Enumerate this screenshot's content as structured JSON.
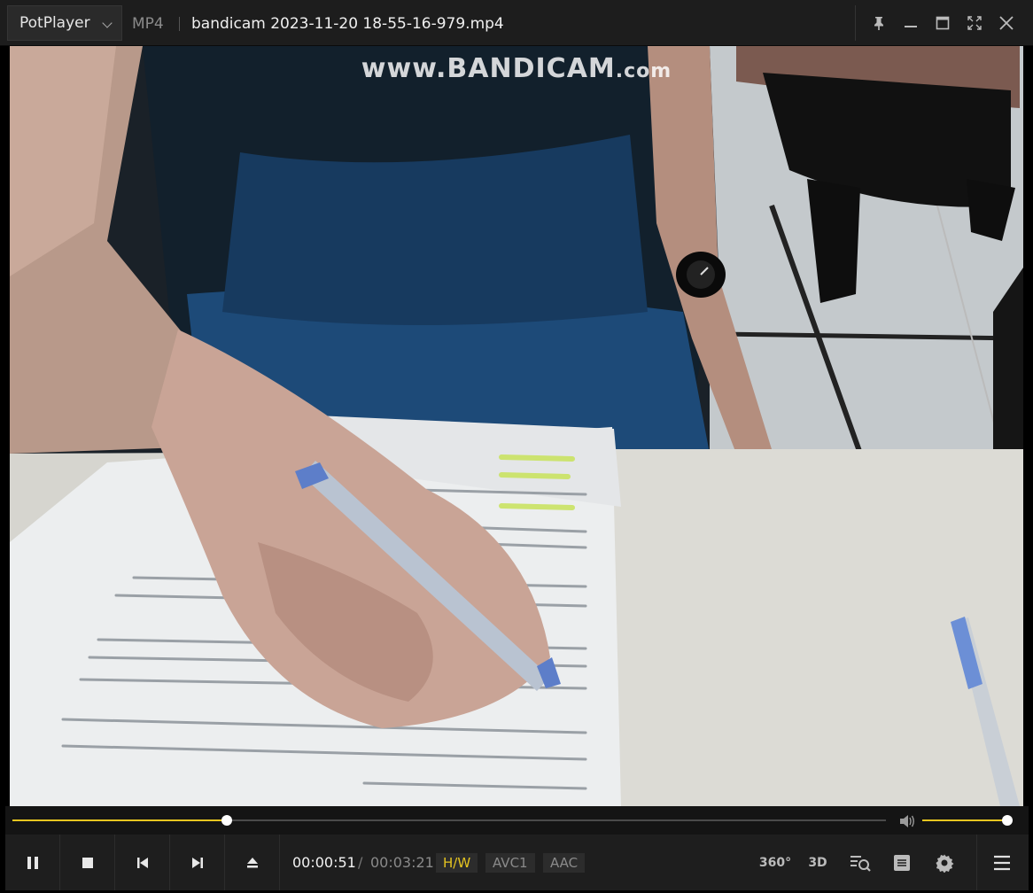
{
  "titlebar": {
    "app_name": "PotPlayer",
    "format": "MP4",
    "filename": "bandicam 2023-11-20 18-55-16-979.mp4",
    "icons": [
      "pin-icon",
      "minimize-icon",
      "maximize-icon",
      "fullscreen-icon",
      "close-icon"
    ]
  },
  "video": {
    "watermark_main": "www.BANDICAM",
    "watermark_suffix": ".com"
  },
  "playback": {
    "progress_fraction": 0.245,
    "volume_fraction": 1.0,
    "current_time": "00:00:51",
    "separator": "/",
    "total_time": "00:03:21"
  },
  "tags": {
    "hw": "H/W",
    "video_codec": "AVC1",
    "audio_codec": "AAC"
  },
  "labels": {
    "vr": "360°",
    "stereo": "3D"
  },
  "colors": {
    "accent": "#e6c520",
    "background": "#1e1e1e"
  }
}
